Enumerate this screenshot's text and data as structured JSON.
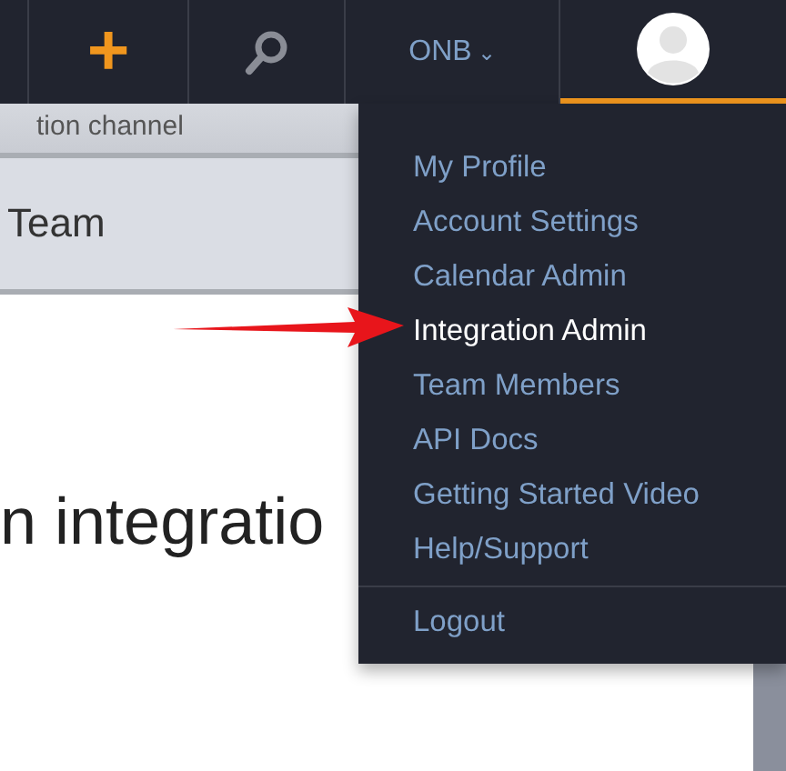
{
  "navbar": {
    "add_icon": "+",
    "org_menu": {
      "label": "ONB",
      "caret": "⌄"
    },
    "avatar": {
      "selected": true
    }
  },
  "content": {
    "panels": [
      {
        "text": "tion channel"
      },
      {
        "text": "Team"
      }
    ],
    "heading": "n integratio"
  },
  "user_menu": {
    "items": [
      {
        "label": "My Profile",
        "selected": false
      },
      {
        "label": "Account Settings",
        "selected": false
      },
      {
        "label": "Calendar Admin",
        "selected": false
      },
      {
        "label": "Integration Admin",
        "selected": true
      },
      {
        "label": "Team Members",
        "selected": false
      },
      {
        "label": "API Docs",
        "selected": false
      },
      {
        "label": "Getting Started Video",
        "selected": false
      },
      {
        "label": "Help/Support",
        "selected": false
      }
    ],
    "footer_items": [
      {
        "label": "Logout",
        "selected": false
      }
    ]
  }
}
